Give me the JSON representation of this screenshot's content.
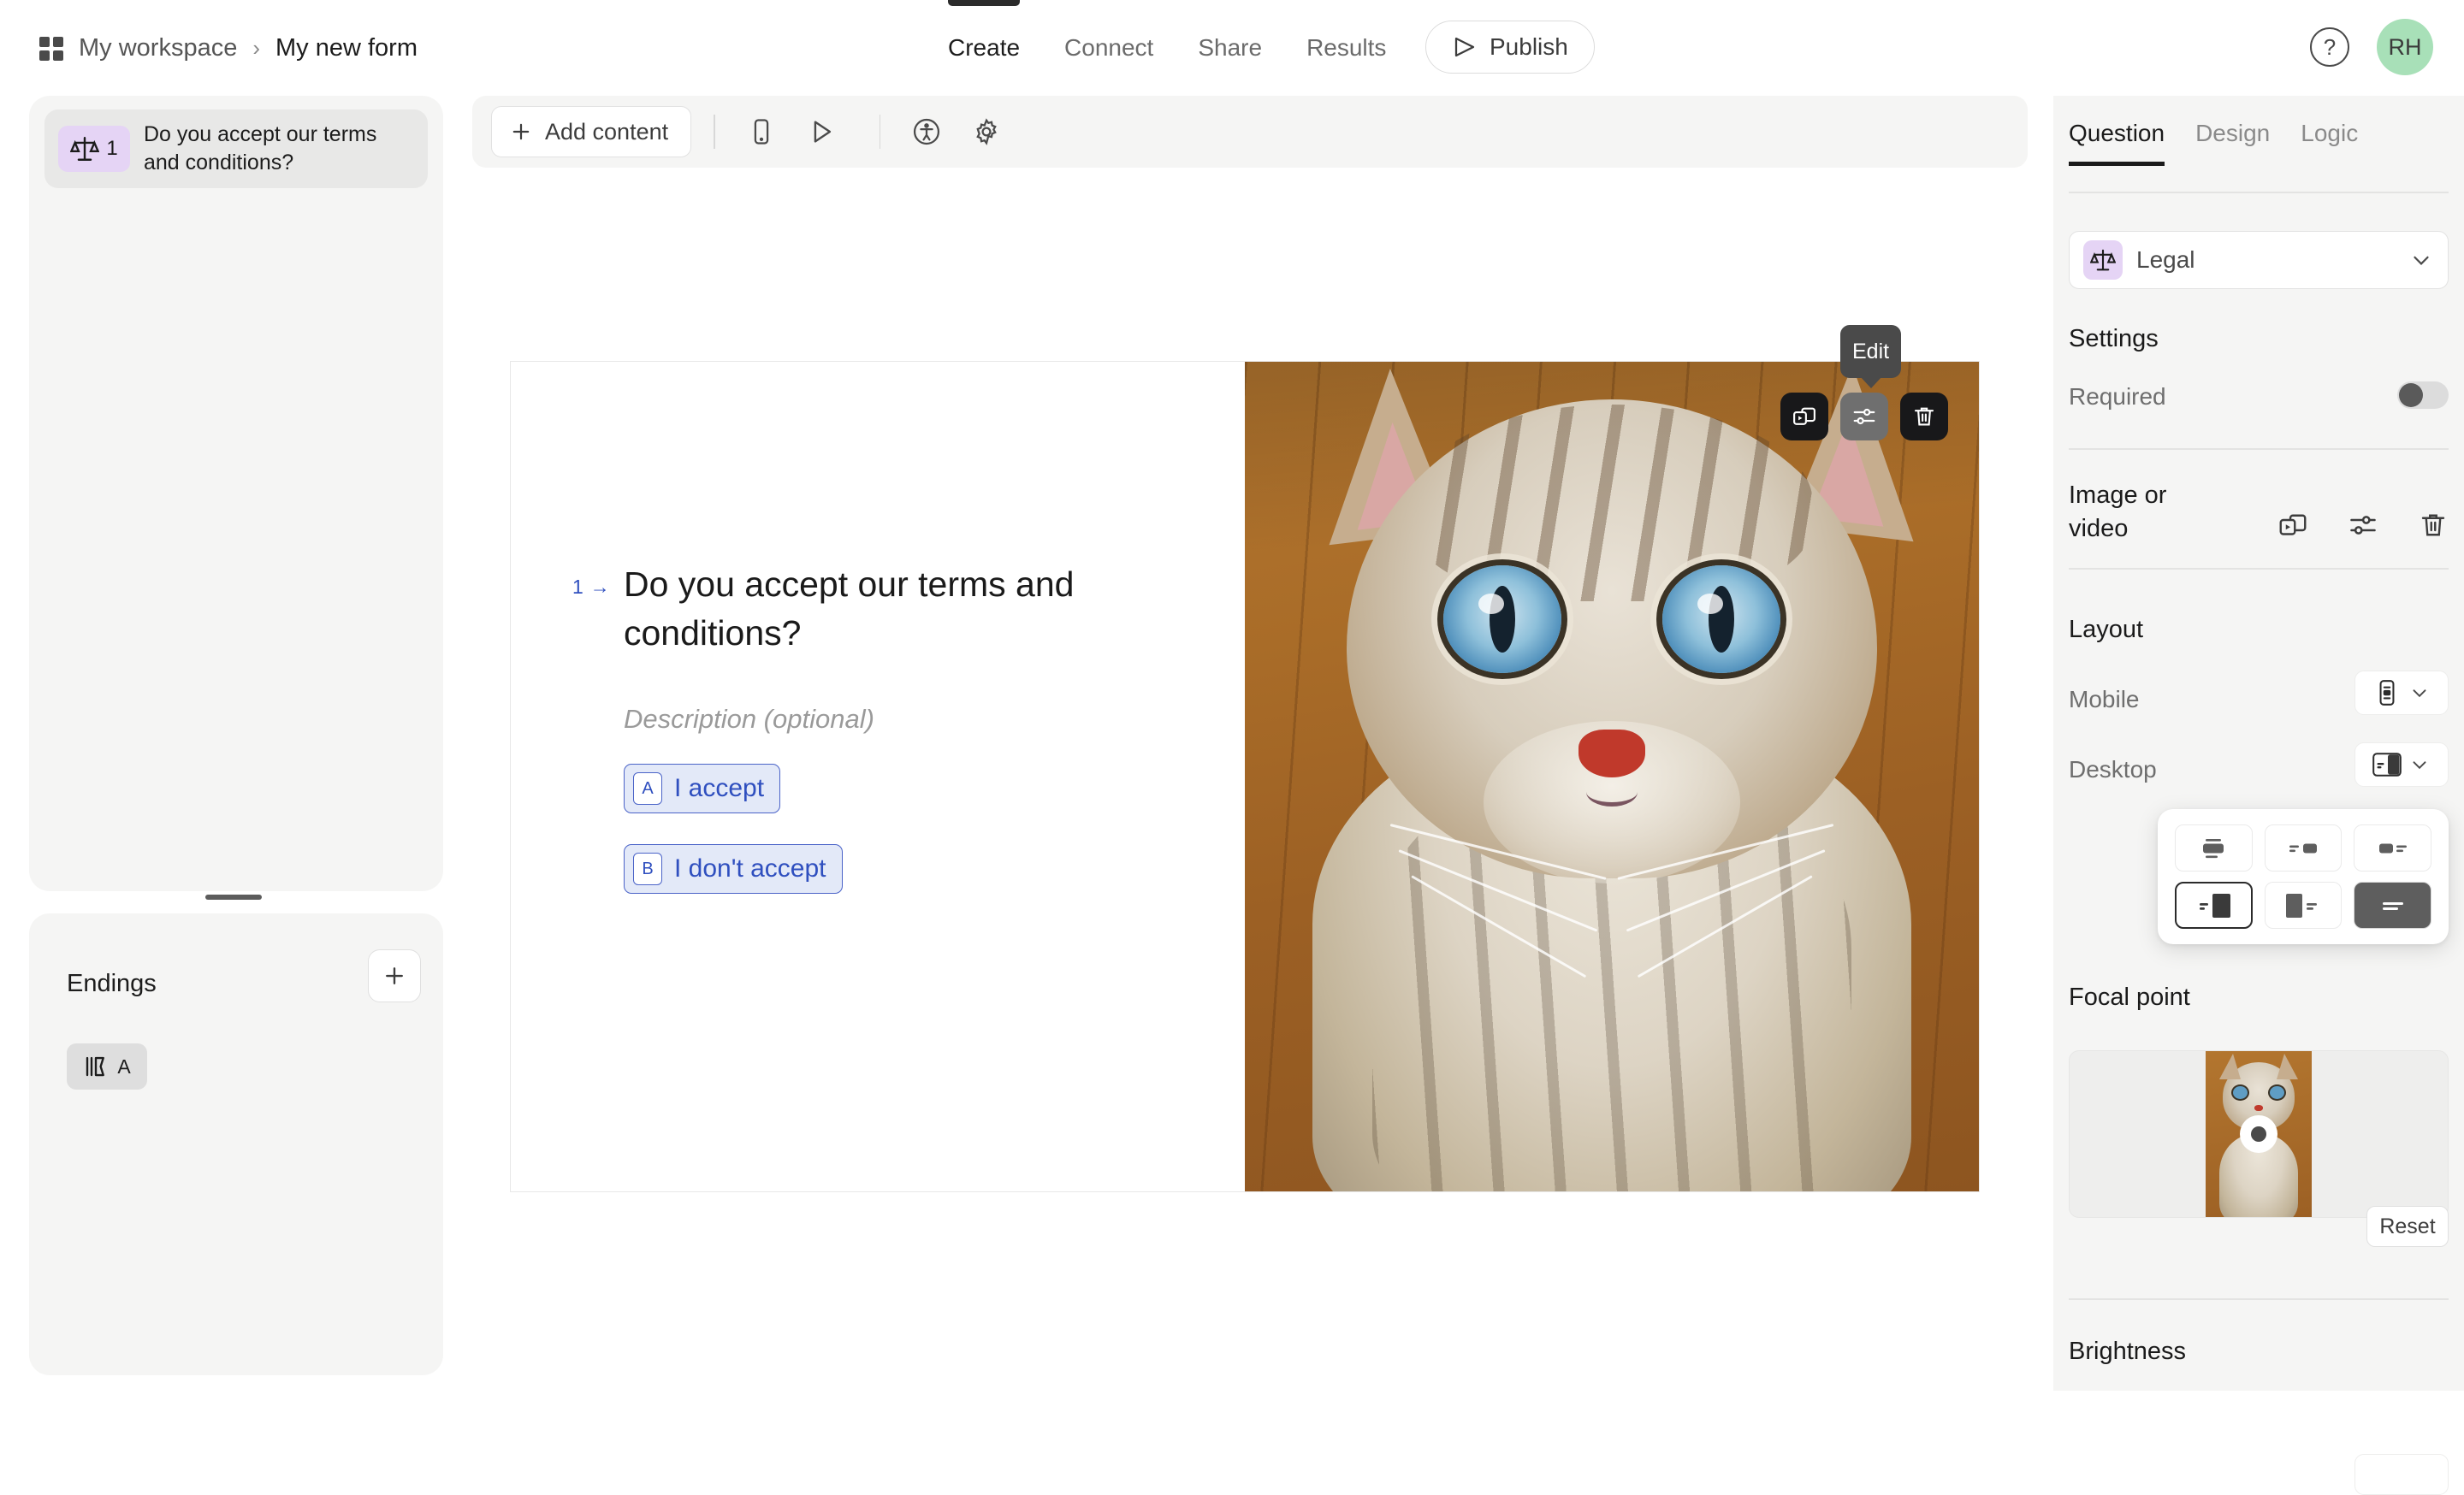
{
  "topbar": {
    "grid_icon": "workspace-grid-icon",
    "breadcrumb_workspace": "My workspace",
    "breadcrumb_separator": "›",
    "breadcrumb_form": "My new form",
    "tabs": [
      {
        "label": "Create",
        "active": true
      },
      {
        "label": "Connect",
        "active": false
      },
      {
        "label": "Share",
        "active": false
      },
      {
        "label": "Results",
        "active": false
      }
    ],
    "publish_label": "Publish",
    "publish_icon": "send-icon",
    "help_icon": "help-circle-icon",
    "help_glyph": "?",
    "avatar_initials": "RH",
    "avatar_color": "#a8e0b8"
  },
  "sidebar": {
    "question_item": {
      "icon": "legal-scales-icon",
      "number": "1",
      "title": "Do you accept our terms and conditions?"
    },
    "endings": {
      "title": "Endings",
      "add_icon": "plus-icon",
      "items": [
        {
          "icon": "ending-flag-icon",
          "letter": "A"
        }
      ]
    }
  },
  "toolbar": {
    "add_content_label": "Add content",
    "add_content_icon": "plus-icon",
    "icons": [
      {
        "name": "mobile-preview-icon"
      },
      {
        "name": "play-preview-icon"
      },
      {
        "name": "accessibility-icon"
      },
      {
        "name": "settings-gear-icon"
      }
    ]
  },
  "canvas": {
    "question_number": "1",
    "question_arrow": "→",
    "question_title": "Do you accept our terms and conditions?",
    "description_placeholder": "Description (optional)",
    "options": [
      {
        "key": "A",
        "label": "I accept"
      },
      {
        "key": "B",
        "label": "I don't accept"
      }
    ],
    "image_actions": [
      {
        "name": "replace-media-icon",
        "hovered": false
      },
      {
        "name": "adjust-sliders-icon",
        "hovered": true
      },
      {
        "name": "delete-trash-icon",
        "hovered": false
      }
    ],
    "tooltip": "Edit",
    "media_alt": "tabby kitten with blue eyes on wooden floor"
  },
  "rightpanel": {
    "tabs": [
      {
        "label": "Question",
        "active": true
      },
      {
        "label": "Design",
        "active": false
      },
      {
        "label": "Logic",
        "active": false
      }
    ],
    "type_select": {
      "icon": "legal-scales-icon",
      "value": "Legal",
      "chevron": "chevron-down-icon"
    },
    "settings_heading": "Settings",
    "required_label": "Required",
    "required_on": false,
    "image_or_video_label": "Image or video",
    "image_or_video_icons": [
      {
        "name": "replace-media-icon"
      },
      {
        "name": "adjust-sliders-icon"
      },
      {
        "name": "delete-trash-icon"
      }
    ],
    "layout_heading": "Layout",
    "mobile_label": "Mobile",
    "mobile_layout": "stacked-vertical",
    "desktop_label": "Desktop",
    "desktop_layout": "text-left-image-right",
    "layout_options": [
      {
        "name": "layout-stacked-centered",
        "selected": false
      },
      {
        "name": "layout-text-left-small-image-right",
        "selected": false
      },
      {
        "name": "layout-small-image-left-text-right",
        "selected": false
      },
      {
        "name": "layout-text-left-image-right",
        "selected": true
      },
      {
        "name": "layout-image-left-text-right",
        "selected": false
      },
      {
        "name": "layout-full-background",
        "selected": false
      }
    ],
    "focal_point_label": "Focal point",
    "focal_marker": "focal-point-marker",
    "reset_label": "Reset",
    "brightness_label": "Brightness"
  }
}
